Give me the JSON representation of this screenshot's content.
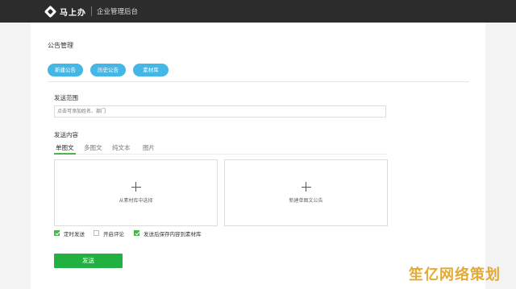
{
  "header": {
    "brand": "马上办",
    "console_title": "企业管理后台"
  },
  "page": {
    "title": "公告管理"
  },
  "actions": [
    {
      "label": "新建公告"
    },
    {
      "label": "历史公告"
    },
    {
      "label": "素材库"
    }
  ],
  "scope": {
    "label": "发送范围",
    "placeholder": "点击可添加姓名、部门"
  },
  "content": {
    "label": "发送内容",
    "tabs": [
      "单图文",
      "多图文",
      "纯文本",
      "图片"
    ],
    "active_tab": "单图文",
    "cards": [
      {
        "label": "从素材库中选择"
      },
      {
        "label": "新建单图文公告"
      }
    ]
  },
  "options": [
    {
      "label": "定时发送",
      "checked": true
    },
    {
      "label": "开启评论",
      "checked": false
    },
    {
      "label": "发送后保存内容到素材库",
      "checked": true
    }
  ],
  "submit": {
    "label": "发送"
  },
  "watermark": "笙亿网络策划",
  "colors": {
    "topbar": "#2c2c2c",
    "accent_blue": "#44b7e7",
    "accent_green": "#21b142",
    "watermark": "#e0a11f"
  }
}
